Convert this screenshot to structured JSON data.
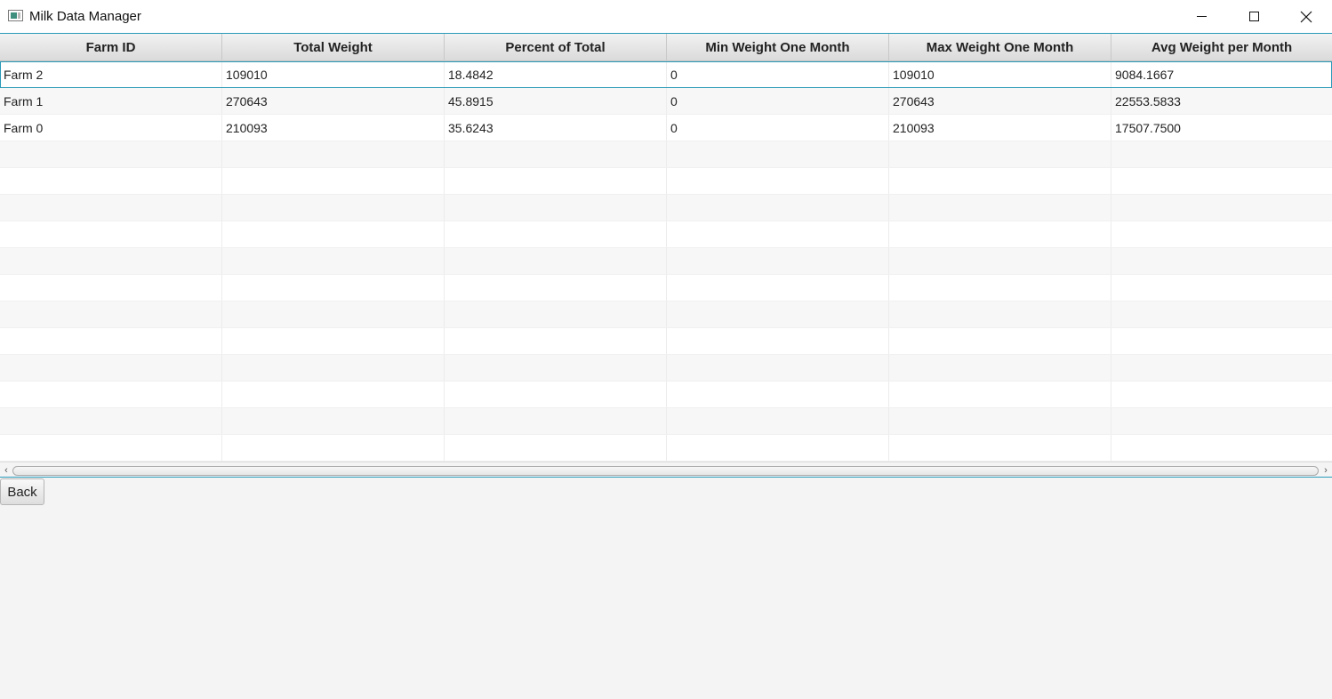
{
  "window": {
    "title": "Milk Data Manager",
    "icons": {
      "app": "app-window-icon",
      "minimize": "minimize-icon",
      "maximize": "maximize-icon",
      "close": "close-icon"
    }
  },
  "table": {
    "columns": [
      "Farm ID",
      "Total Weight",
      "Percent of Total",
      "Min Weight One Month",
      "Max Weight One Month",
      "Avg Weight per Month"
    ],
    "rows": [
      [
        "Farm 2",
        "109010",
        "18.4842",
        "0",
        "109010",
        "9084.1667"
      ],
      [
        "Farm 1",
        "270643",
        "45.8915",
        "0",
        "270643",
        "22553.5833"
      ],
      [
        "Farm 0",
        "210093",
        "35.6243",
        "0",
        "210093",
        "17507.7500"
      ]
    ],
    "selected_row": 0,
    "colors": {
      "accent": "#2a9ab8",
      "row_alt": "#f7f7f7"
    }
  },
  "scrollbar": {
    "left_glyph": "‹",
    "right_glyph": "›"
  },
  "actions": {
    "back_label": "Back"
  }
}
